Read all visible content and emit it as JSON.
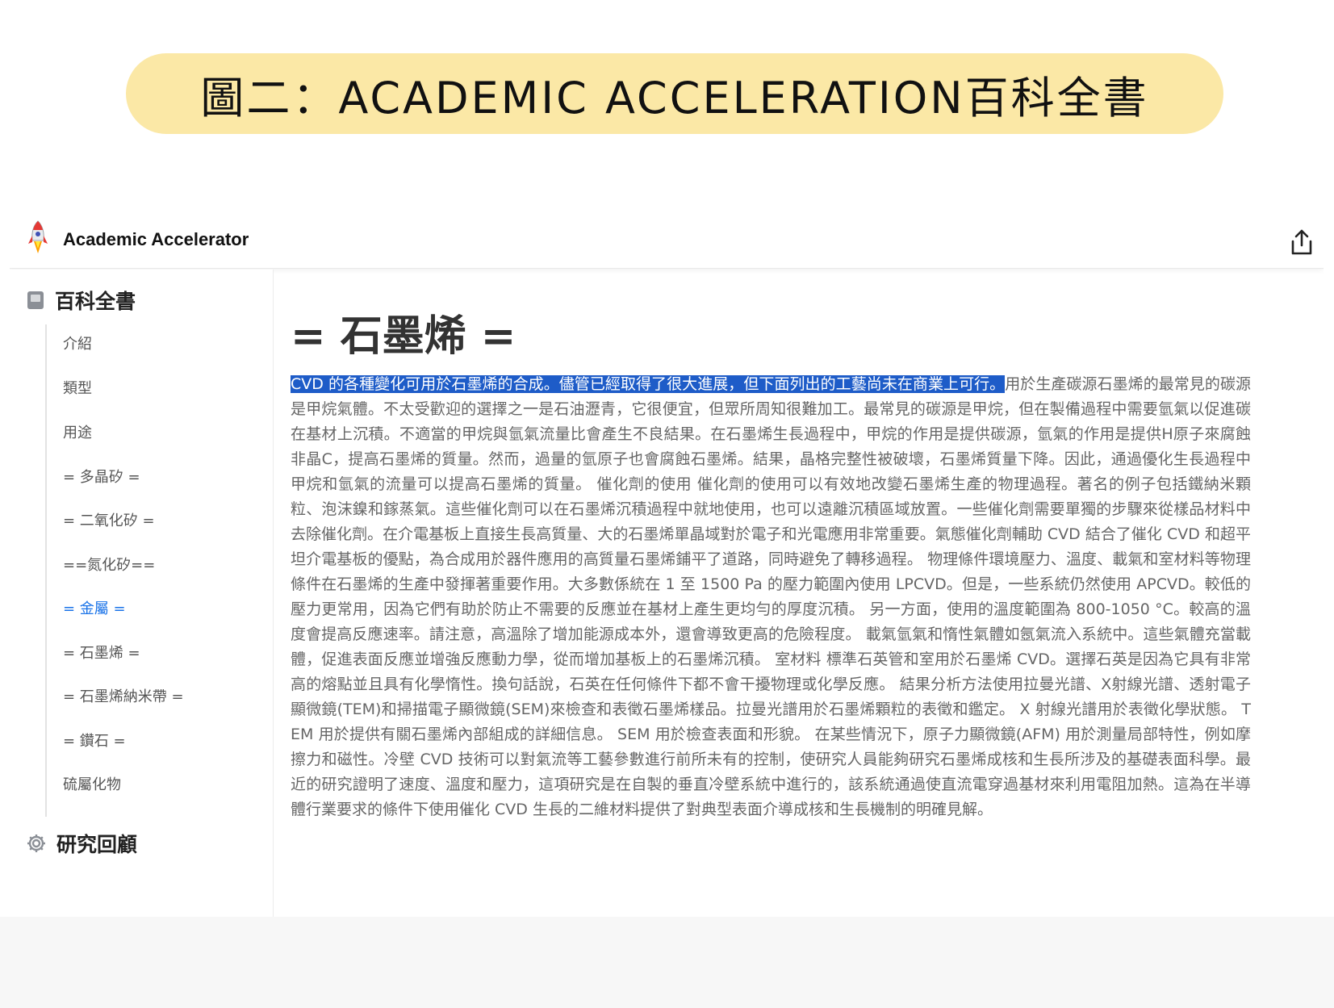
{
  "banner": {
    "title": "圖二：ACADEMIC ACCELERATION百科全書"
  },
  "app": {
    "name": "Academic Accelerator"
  },
  "icons": {
    "logo": "rocket-icon",
    "share": "share-icon",
    "section": "book-icon",
    "footer": "gear-icon"
  },
  "colors": {
    "accent": "#1a73e8",
    "highlight": "#1e5cc8",
    "banner_bg": "#fbe8a6"
  },
  "sidebar": {
    "header": "百科全書",
    "items": [
      {
        "label": "介紹",
        "active": false
      },
      {
        "label": "類型",
        "active": false
      },
      {
        "label": "用途",
        "active": false
      },
      {
        "label": "= 多晶矽 =",
        "active": false
      },
      {
        "label": "= 二氧化矽 =",
        "active": false
      },
      {
        "label": "==氮化矽==",
        "active": false
      },
      {
        "label": "= 金屬 =",
        "active": true
      },
      {
        "label": "= 石墨烯 =",
        "active": false
      },
      {
        "label": "= 石墨烯納米帶 =",
        "active": false
      },
      {
        "label": "= 鑽石 =",
        "active": false
      },
      {
        "label": "硫屬化物",
        "active": false
      }
    ],
    "footer": "研究回顧"
  },
  "article": {
    "heading": "= 石墨烯 =",
    "highlighted": "CVD 的各種變化可用於石墨烯的合成。儘管已經取得了很大進展，但下面列出的工藝尚未在商業上可行。",
    "body": "用於生產碳源石墨烯的最常見的碳源是甲烷氣體。不太受歡迎的選擇之一是石油瀝青，它很便宜，但眾所周知很難加工。最常見的碳源是甲烷，但在製備過程中需要氫氣以促進碳在基材上沉積。不適當的甲烷與氫氣流量比會產生不良結果。在石墨烯生長過程中，甲烷的作用是提供碳源，氫氣的作用是提供H原子來腐蝕非晶C，提高石墨烯的質量。然而，過量的氫原子也會腐蝕石墨烯。結果，晶格完整性被破壞，石墨烯質量下降。因此，通過優化生長過程中甲烷和氫氣的流量可以提高石墨烯的質量。 催化劑的使用 催化劑的使用可以有效地改變石墨烯生產的物理過程。著名的例子包括鐵納米顆粒、泡沫鎳和鎵蒸氣。這些催化劑可以在石墨烯沉積過程中就地使用，也可以遠離沉積區域放置。一些催化劑需要單獨的步驟來從樣品材料中去除催化劑。在介電基板上直接生長高質量、大的石墨烯單晶域對於電子和光電應用非常重要。氣態催化劑輔助 CVD 結合了催化 CVD 和超平坦介電基板的優點，為合成用於器件應用的高質量石墨烯鋪平了道路，同時避免了轉移過程。 物理條件環境壓力、溫度、載氣和室材料等物理條件在石墨烯的生產中發揮著重要作用。大多數係統在 1 至 1500 Pa 的壓力範圍內使用 LPCVD。但是，一些系統仍然使用 APCVD。較低的壓力更常用，因為它們有助於防止不需要的反應並在基材上產生更均勻的厚度沉積。 另一方面，使用的溫度範圍為 800-1050 °C。較高的溫度會提高反應速率。請注意，高溫除了增加能源成本外，還會導致更高的危險程度。 載氣氫氣和惰性氣體如氬氣流入系統中。這些氣體充當載體，促進表面反應並增強反應動力學，從而增加基板上的石墨烯沉積。 室材料 標準石英管和室用於石墨烯 CVD。選擇石英是因為它具有非常高的熔點並且具有化學惰性。換句話說，石英在任何條件下都不會干擾物理或化學反應。 結果分析方法使用拉曼光譜、X射線光譜、透射電子顯微鏡(TEM)和掃描電子顯微鏡(SEM)來檢查和表徵石墨烯樣品。拉曼光譜用於石墨烯顆粒的表徵和鑑定。 X 射線光譜用於表徵化學狀態。 TEM 用於提供有關石墨烯內部組成的詳細信息。 SEM 用於檢查表面和形貌。 在某些情況下，原子力顯微鏡(AFM) 用於測量局部特性，例如摩擦力和磁性。冷壁 CVD 技術可以對氣流等工藝參數進行前所未有的控制，使研究人員能夠研究石墨烯成核和生長所涉及的基礎表面科學。最近的研究證明了速度、溫度和壓力，這項研究是在自製的垂直冷壁系統中進行的，該系統通過使直流電穿過基材來利用電阻加熱。這為在半導體行業要求的條件下使用催化 CVD 生長的二維材料提供了對典型表面介導成核和生長機制的明確見解。"
  }
}
